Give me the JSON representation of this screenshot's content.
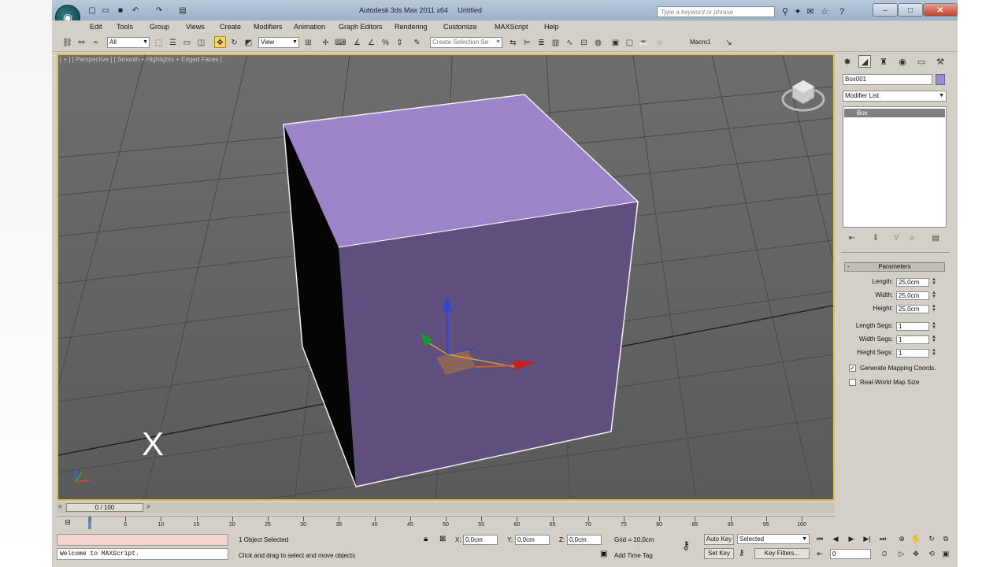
{
  "window": {
    "title": "Autodesk 3ds Max 2011 x64",
    "document": "Untitled",
    "search_placeholder": "Type a keyword or phrase",
    "app_icon": "3ds-max-logo-icon",
    "controls": [
      "minimize-icon",
      "maximize-icon",
      "close-icon"
    ]
  },
  "menu": {
    "items": [
      "Edit",
      "Tools",
      "Group",
      "Views",
      "Create",
      "Modifiers",
      "Animation",
      "Graph Editors",
      "Rendering",
      "Customize",
      "MAXScript",
      "Help"
    ]
  },
  "toolbar": {
    "selection_filter": "All",
    "ref_coord": "View",
    "named_selection": "Create Selection Se",
    "macro_label": "Macro1"
  },
  "viewport": {
    "label": "[ + ] [ Perspective ] [ Smooth + Highlights + Edged Faces ]",
    "overlay_mark": "X",
    "object_color": "#9b84c8",
    "axis_labels": {
      "x": "x",
      "y": "y",
      "z": "z"
    }
  },
  "command_panel": {
    "object_name": "Box001",
    "object_color": "#9d8ad0",
    "modifier_list": "Modifier List",
    "stack_item": "Box",
    "rollout_title": "Parameters",
    "params": [
      {
        "label": "Length:",
        "value": "25,0cm"
      },
      {
        "label": "Width:",
        "value": "25,0cm"
      },
      {
        "label": "Height:",
        "value": "25,0cm"
      }
    ],
    "segs": [
      {
        "label": "Length Segs:",
        "value": "1"
      },
      {
        "label": "Width Segs:",
        "value": "1"
      },
      {
        "label": "Height Segs:",
        "value": "1"
      }
    ],
    "generate_mapping": {
      "label": "Generate Mapping Coords.",
      "checked": true
    },
    "real_world": {
      "label": "Real-World Map Size",
      "checked": false
    }
  },
  "timeline": {
    "slider_label": "0 / 100",
    "ticks": [
      "0",
      "5",
      "10",
      "15",
      "20",
      "25",
      "30",
      "35",
      "40",
      "45",
      "50",
      "55",
      "60",
      "65",
      "70",
      "75",
      "80",
      "85",
      "90",
      "95",
      "100"
    ]
  },
  "status": {
    "listener_text": "Welcome to MAXScript.",
    "selected": "1 Object Selected",
    "prompt": "Click and drag to select and move objects",
    "x": "0,0cm",
    "y": "0,0cm",
    "z": "0,0cm",
    "grid": "Grid = 10,0cm",
    "auto_key": "Auto Key",
    "set_key": "Set Key",
    "key_mode": "Selected",
    "key_filters": "Key Filters...",
    "add_time_tag": "Add Time Tag",
    "frame": "0"
  }
}
